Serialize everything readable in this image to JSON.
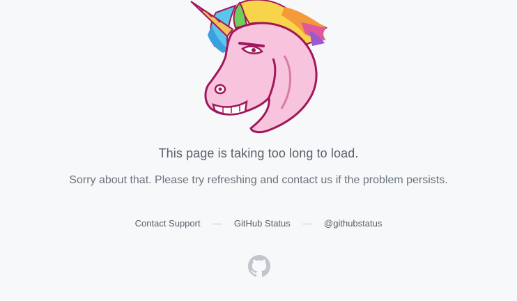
{
  "error": {
    "headline": "This page is taking too long to load.",
    "message": "Sorry about that. Please try refreshing and contact us if the problem persists."
  },
  "links": {
    "support": "Contact Support",
    "status": "GitHub Status",
    "twitter": "@githubstatus",
    "separator": "—"
  },
  "icons": {
    "hero": "angry-unicorn-illustration",
    "footer": "github-octocat-icon"
  },
  "colors": {
    "background": "#f6f8fa",
    "text_primary": "#586069",
    "text_secondary": "#6a737d",
    "unicorn_body": "#f8c3dc",
    "unicorn_outline": "#a0175b"
  }
}
